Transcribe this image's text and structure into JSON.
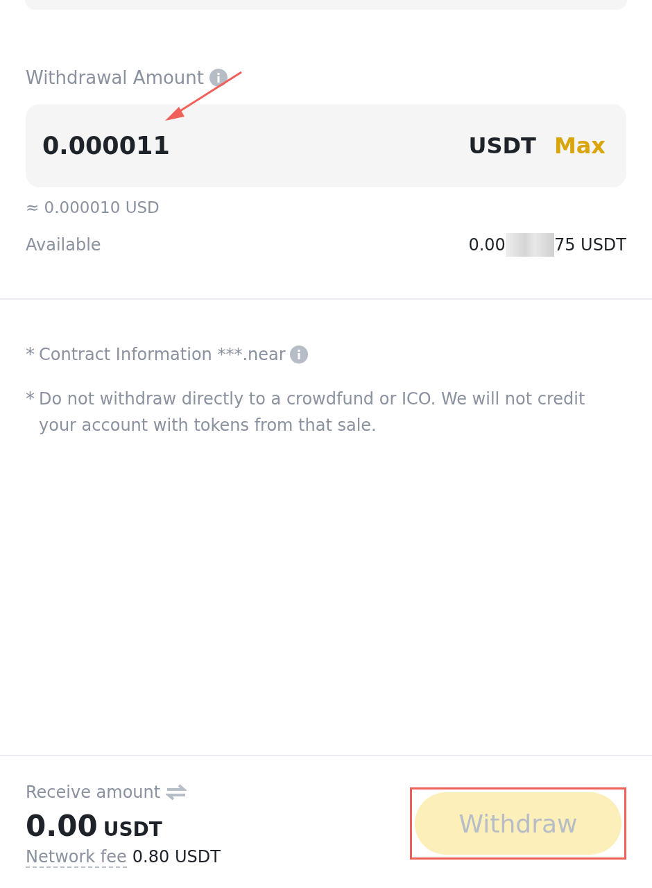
{
  "amount_field": {
    "label": "Withdrawal Amount",
    "value": "0.000011",
    "currency": "USDT",
    "max_link": "Max"
  },
  "usd_estimate": "≈ 0.000010 USD",
  "available": {
    "label": "Available",
    "value_start": "0.00",
    "value_end": "75 USDT",
    "redacted": true
  },
  "notes": [
    {
      "mark": "*",
      "text": "Contract Information ***.near",
      "info": true
    },
    {
      "mark": "*",
      "text": "Do not withdraw directly to a crowdfund or ICO. We will not credit your account with tokens from that sale.",
      "info": false
    }
  ],
  "footer": {
    "receive_label": "Receive amount",
    "receive_value": "0.00",
    "receive_currency": "USDT",
    "fee_label": "Network fee",
    "fee_value": "0.80 USDT",
    "button": {
      "label": "Withdraw",
      "disabled": true,
      "highlighted": true
    }
  },
  "annotation_arrow": true
}
